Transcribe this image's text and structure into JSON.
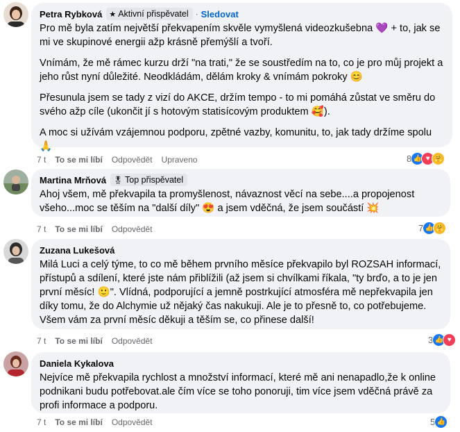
{
  "comments": [
    {
      "author": "Petra Rybková",
      "badge": "Aktivní přispěvatel",
      "badge_icon": "star-icon",
      "follow": "Sledovat",
      "dot": "·",
      "paragraphs": [
        "Pro mě byla zatím největší překvapením skvěle vymyšlená videozkušebna 💜 + to, jak se mi ve skupinové energii ažp krásně přemýšlí a tvoří.",
        "Vnímám, že mě rámec kurzu drží \"na trati,\" že se soustředím na to, co je pro můj projekt a jeho růst nyní důležité. Neodkládám, dělám kroky & vnímám pokroky 😊",
        "Přesunula jsem se tady z vizí do AKCE, držím tempo - to mi pomáhá zůstat ve směru do svého ažp cíle (ukončit jí s hotovým statisícovým produktem 🥰).",
        "A moc si užívám vzájemnou podporu, zpětné vazby, komunitu, to, jak tady držíme spolu 🙏"
      ],
      "time": "7 t",
      "like": "To se mi líbí",
      "reply": "Odpovědět",
      "edited": "Upraveno",
      "reaction_count": "8",
      "reactions": [
        "like-icon",
        "love-icon",
        "care-icon"
      ]
    },
    {
      "author": "Martina Mrňová",
      "badge": "Top přispěvatel",
      "badge_icon": "award-icon",
      "paragraphs": [
        "Ahoj všem, mě překvapila ta promyšlenost, návaznost věcí na sebe....a propojenost všeho...moc se těším na \"další díly\" 😍 a jsem vděčná, že jsem součástí 💥"
      ],
      "time": "7 t",
      "like": "To se mi líbí",
      "reply": "Odpovědět",
      "reaction_count": "7",
      "reactions": [
        "like-icon",
        "care-icon"
      ]
    },
    {
      "author": "Zuzana Lukešová",
      "paragraphs": [
        "Milá Luci a celý týme, to co mě během prvního měsíce překvapilo byl ROZSAH informací, přístupů a sdílení, které jste nám přiblížili (až jsem si chvílkami říkala, \"ty brďo, a to je jen první měsíc! 🙂\". Vlídná, podporující a jemně postrkující atmosféra mě nepřekvapila jen díky tomu, že do Alchymie už nějaký čas nakukuji. Ale je to přesně to, co potřebujeme. Všem vám za první měsíc děkuji a těším se, co přinese další!"
      ],
      "time": "7 t",
      "like": "To se mi líbí",
      "reply": "Odpovědět",
      "reaction_count": "3",
      "reactions": [
        "like-icon",
        "love-icon"
      ]
    },
    {
      "author": "Daniela Kykalova",
      "paragraphs": [
        "Nejvíce mě překvapila rychlost a množství informací, které mě ani nenapadlo,že k online podnikani budu potřebovat.ale čím více se toho ponoruji, tim více jsem vděčná právě za profi informace a podporu."
      ],
      "time": "7 t",
      "like": "To se mi líbí",
      "reply": "Odpovědět",
      "reaction_count": "5",
      "reactions": [
        "like-icon"
      ]
    }
  ],
  "colors": {
    "bubble": "#f0f2f5",
    "link": "#0064d1",
    "like": "#1877f2",
    "love": "#f33e58",
    "care": "#f7b928"
  }
}
